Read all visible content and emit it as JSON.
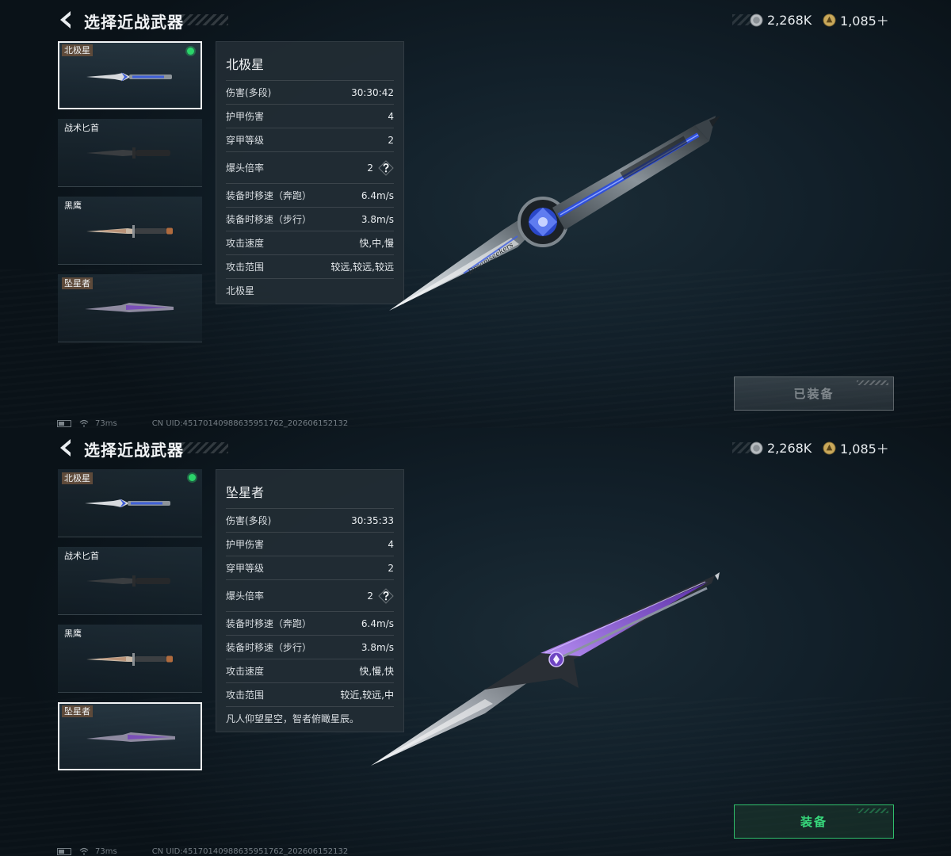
{
  "screens": [
    {
      "title": "选择近战武器",
      "currency": {
        "silver": "2,268K",
        "gold": "1,085＋"
      },
      "weapons": [
        {
          "name": "北极星",
          "tag": true,
          "selected": true,
          "equipped": true
        },
        {
          "name": "战术匕首",
          "tag": false,
          "selected": false,
          "equipped": false
        },
        {
          "name": "黑鹰",
          "tag": false,
          "selected": false,
          "equipped": false
        },
        {
          "name": "坠星者",
          "tag": true,
          "selected": false,
          "equipped": false
        }
      ],
      "detail": {
        "name": "北极星",
        "stats": [
          {
            "label": "伤害(多段)",
            "value": "30:30:42"
          },
          {
            "label": "护甲伤害",
            "value": "4"
          },
          {
            "label": "穿甲等级",
            "value": "2"
          },
          {
            "label": "爆头倍率",
            "value": "2",
            "help": true
          },
          {
            "label": "装备时移速（奔跑）",
            "value": "6.4m/s"
          },
          {
            "label": "装备时移速（步行）",
            "value": "3.8m/s"
          },
          {
            "label": "攻击速度",
            "value": "快,中,慢"
          },
          {
            "label": "攻击范围",
            "value": "较远,较远,较远"
          }
        ],
        "description": "北极星",
        "engraving": "Dreamseekers"
      },
      "button": {
        "label": "已装备",
        "enabled": false
      },
      "status": {
        "ping": "73ms",
        "uid": "CN UID:45170140988635951762_202606152132"
      }
    },
    {
      "title": "选择近战武器",
      "currency": {
        "silver": "2,268K",
        "gold": "1,085＋"
      },
      "weapons": [
        {
          "name": "北极星",
          "tag": true,
          "selected": false,
          "equipped": true
        },
        {
          "name": "战术匕首",
          "tag": false,
          "selected": false,
          "equipped": false
        },
        {
          "name": "黑鹰",
          "tag": false,
          "selected": false,
          "equipped": false
        },
        {
          "name": "坠星者",
          "tag": true,
          "selected": true,
          "equipped": false
        }
      ],
      "detail": {
        "name": "坠星者",
        "stats": [
          {
            "label": "伤害(多段)",
            "value": "30:35:33"
          },
          {
            "label": "护甲伤害",
            "value": "4"
          },
          {
            "label": "穿甲等级",
            "value": "2"
          },
          {
            "label": "爆头倍率",
            "value": "2",
            "help": true
          },
          {
            "label": "装备时移速（奔跑）",
            "value": "6.4m/s"
          },
          {
            "label": "装备时移速（步行）",
            "value": "3.8m/s"
          },
          {
            "label": "攻击速度",
            "value": "快,慢,快"
          },
          {
            "label": "攻击范围",
            "value": "较近,较远,中"
          }
        ],
        "description": "凡人仰望星空，智者俯瞰星辰。"
      },
      "button": {
        "label": "装备",
        "enabled": true
      },
      "status": {
        "ping": "73ms",
        "uid": "CN UID:45170140988635951762_202606152132"
      }
    }
  ],
  "icons": {
    "back": "chevron-left-icon",
    "silver": "silver-coin-icon",
    "gold": "gold-coin-icon",
    "help": "question-mark-icon",
    "battery": "battery-icon",
    "wifi": "wifi-icon"
  },
  "colors": {
    "equipped_dot": "#2bd46a",
    "equip_button": "#37d97c",
    "tag_background": "#5e4a3a",
    "polaris_accent": "#2f4fd8",
    "starfall_accent": "#8a4fd0"
  }
}
